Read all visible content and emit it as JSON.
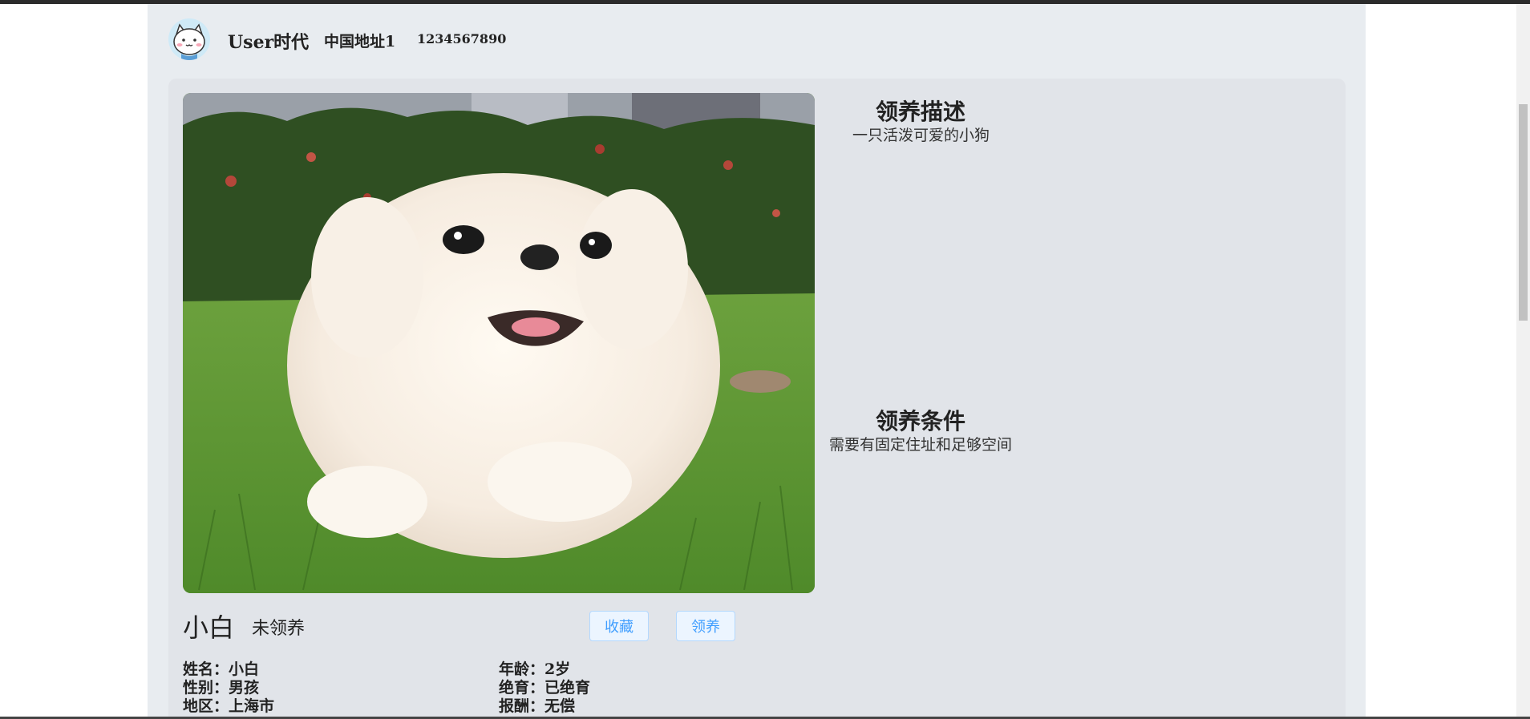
{
  "header": {
    "username": "User时代",
    "address": "中国地址1",
    "phone": "1234567890"
  },
  "pet": {
    "name": "小白",
    "status": "未领养",
    "photo_icon": "dog-photo"
  },
  "adoption_description": {
    "title": "领养描述",
    "text": "一只活泼可爱的小狗"
  },
  "adoption_conditions": {
    "title": "领养条件",
    "text": "需要有固定住址和足够空间"
  },
  "buttons": {
    "favorite": "收藏",
    "adopt": "领养"
  },
  "details": {
    "name_label": "姓名：",
    "name_value": "小白",
    "gender_label": "性别：",
    "gender_value": "男孩",
    "region_label": "地区：",
    "region_value": "上海市",
    "age_label": "年龄：",
    "age_value": "2岁",
    "neuter_label": "绝育：",
    "neuter_value": "已绝育",
    "reward_label": "报酬：",
    "reward_value": "无偿"
  },
  "colors": {
    "page_bg": "#e8ecf0",
    "card_bg": "#e1e4e9",
    "button_text": "#409eff",
    "button_bg": "#ecf5ff",
    "button_border": "#b3d8ff"
  }
}
